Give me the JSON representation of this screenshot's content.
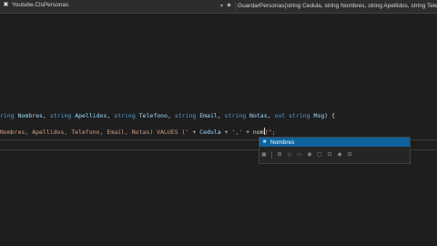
{
  "nav_bar": {
    "project": "Youtube.ClsPersonas",
    "member": "GuardarPersonas(string Cedula, string Nombres, string Apellidos, string Telefono,"
  },
  "code": {
    "signature": {
      "part1": "ring ",
      "p1": "Nombres",
      "part2": ", ",
      "kw2": "string",
      "part3": " ",
      "p2": "Apellidos",
      "part4": ", ",
      "kw3": "string",
      "part5": " ",
      "p3": "Telefono",
      "part6": ", ",
      "kw4": "string",
      "part7": " ",
      "p4": "Email",
      "part8": ", ",
      "kw5": "string",
      "part9": " ",
      "p5": "Notas",
      "part10": ", ",
      "kw6": "out",
      "part11": " ",
      "kw7": "string",
      "part12": " ",
      "p6": "Msg",
      "part13": ") {"
    },
    "insert_line": {
      "s1": "Nombres, Apellidos, Telefono, Email, Notas) VALUES ('",
      "op1": " + ",
      "id1": "Cedula",
      "op2": " + ",
      "s2": "','",
      "op3": " + ",
      "typed": "nom",
      "rest": ")\";"
    }
  },
  "completion": {
    "item_icon": "field-icon",
    "item_label": "Nombres",
    "filters": [
      "[■]",
      "{}",
      "⊞",
      "◇",
      "▭",
      "◉",
      "▢",
      "⊡",
      "◆",
      "⊟"
    ]
  }
}
